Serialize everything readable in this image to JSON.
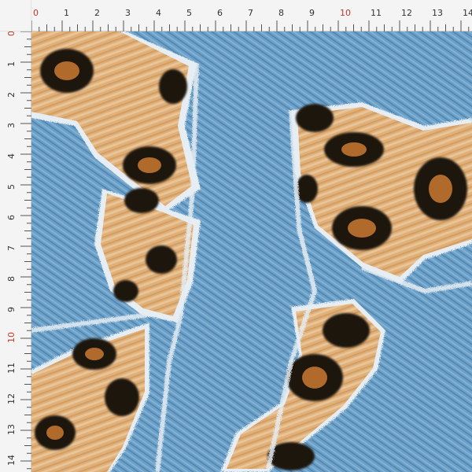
{
  "ruler": {
    "top_labels": [
      "0",
      "1",
      "2",
      "3",
      "4",
      "5",
      "6",
      "7",
      "8",
      "9",
      "10",
      "11",
      "12",
      "13",
      "14"
    ],
    "left_labels": [
      "0",
      "1",
      "2",
      "3",
      "4",
      "5",
      "6",
      "7",
      "8",
      "9",
      "10",
      "11",
      "12",
      "13",
      "14"
    ],
    "accent_color": "#c0392b",
    "text_color": "#333333",
    "tick_color": "#555555",
    "accent_labels": [
      "0",
      "10"
    ]
  },
  "pattern": {
    "denim_light": "#8fb7d6",
    "denim_mid": "#5f93bf",
    "denim_dark": "#2f5e87",
    "fray": "#e6eef4",
    "fur_light": "#e9c79b",
    "fur_mid": "#d9a66a",
    "fur_dark": "#b06a2c",
    "spot": "#1e140e"
  }
}
